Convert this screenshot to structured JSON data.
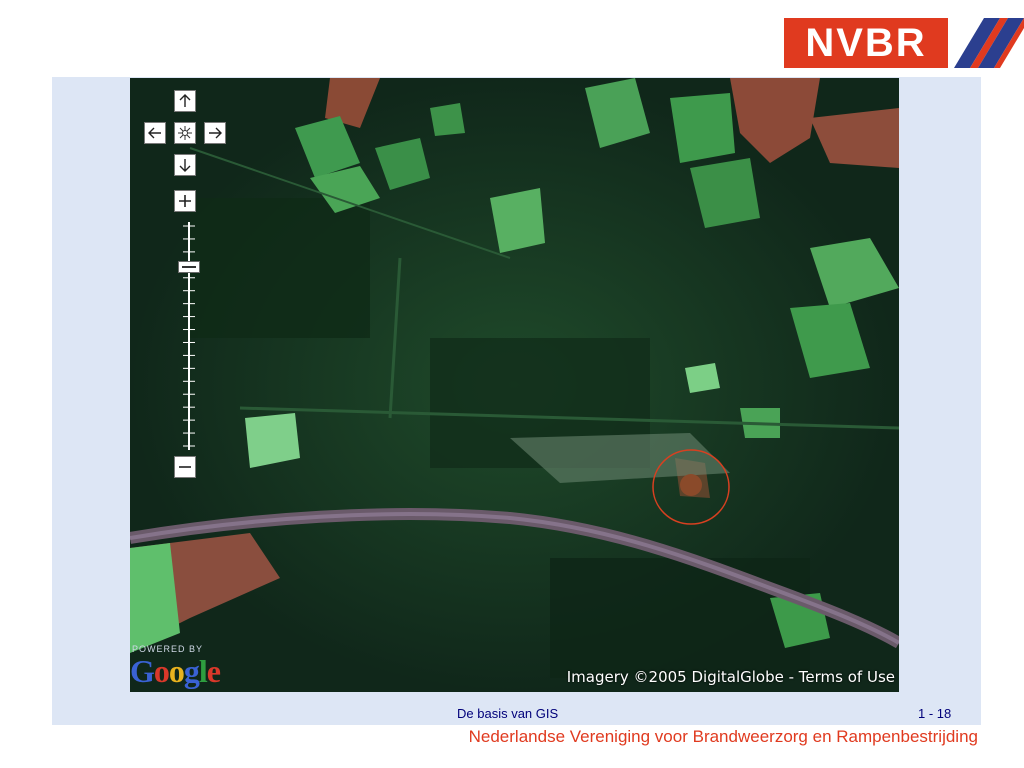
{
  "logo": {
    "text": "NVBR",
    "brand_color": "#e03a1f",
    "stripe_color": "#2b3f8f"
  },
  "map": {
    "controls": {
      "pan_up_icon": "arrow-up-icon",
      "pan_left_icon": "arrow-left-icon",
      "pan_right_icon": "arrow-right-icon",
      "pan_down_icon": "arrow-down-icon",
      "recenter_icon": "recenter-icon",
      "zoom_in_icon": "plus-icon",
      "zoom_out_icon": "minus-icon",
      "zoom_slider_level": 0.82
    },
    "powered_by": "POWERED BY",
    "google_letters": [
      "G",
      "o",
      "o",
      "g",
      "l",
      "e"
    ],
    "attribution": "Imagery ©2005 DigitalGlobe - ",
    "terms_link": "Terms of Use",
    "highlight_color": "#d84020"
  },
  "footer": {
    "title": "De basis van GIS",
    "page": "1 - 18",
    "organization": "Nederlandse Vereniging voor Brandweerzorg en Rampenbestrijding"
  }
}
